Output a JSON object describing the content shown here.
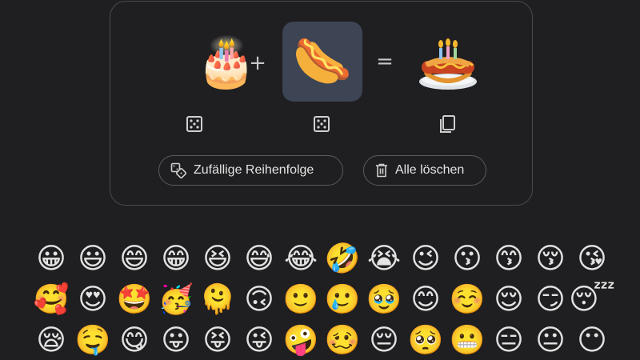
{
  "mixer": {
    "left_emoji": "🎂",
    "left_emoji_name": "birthday cake",
    "plus": "+",
    "right_emoji": "🌭",
    "right_emoji_name": "hot dog",
    "equals": "=",
    "result_emoji": "🎂🌭",
    "result_emoji_name": "birthday cake hot dog mashup",
    "left_randomize_icon": "dice-icon",
    "right_randomize_icon": "dice-icon",
    "copy_icon": "copy-icon"
  },
  "actions": {
    "shuffle_label": "Zufällige Reihenfolge",
    "shuffle_icon": "shuffle-dice-icon",
    "clear_label": "Alle löschen",
    "clear_icon": "trash-icon"
  },
  "emoji_grid": [
    "😀",
    "😃",
    "😄",
    "😁",
    "😆",
    "😅",
    "😂",
    "🤣",
    "😭",
    "😉",
    "😗",
    "😙",
    "😚",
    "😘",
    "🥰",
    "😍",
    "🤩",
    "🥳",
    "🫠",
    "🙃",
    "🙂",
    "🥲",
    "🥹",
    "😊",
    "☺️",
    "😌",
    "😏",
    "😴",
    "😪",
    "🤤",
    "😋",
    "😛",
    "😝",
    "😜",
    "🤪",
    "🥴",
    "😔",
    "🥺",
    "😬",
    "😑",
    "😐",
    "😶"
  ],
  "colors": {
    "background": "#1f1f21",
    "card_border": "#4a4a4d",
    "selected_slot": "#3d4454",
    "text": "#e3e3e3"
  }
}
